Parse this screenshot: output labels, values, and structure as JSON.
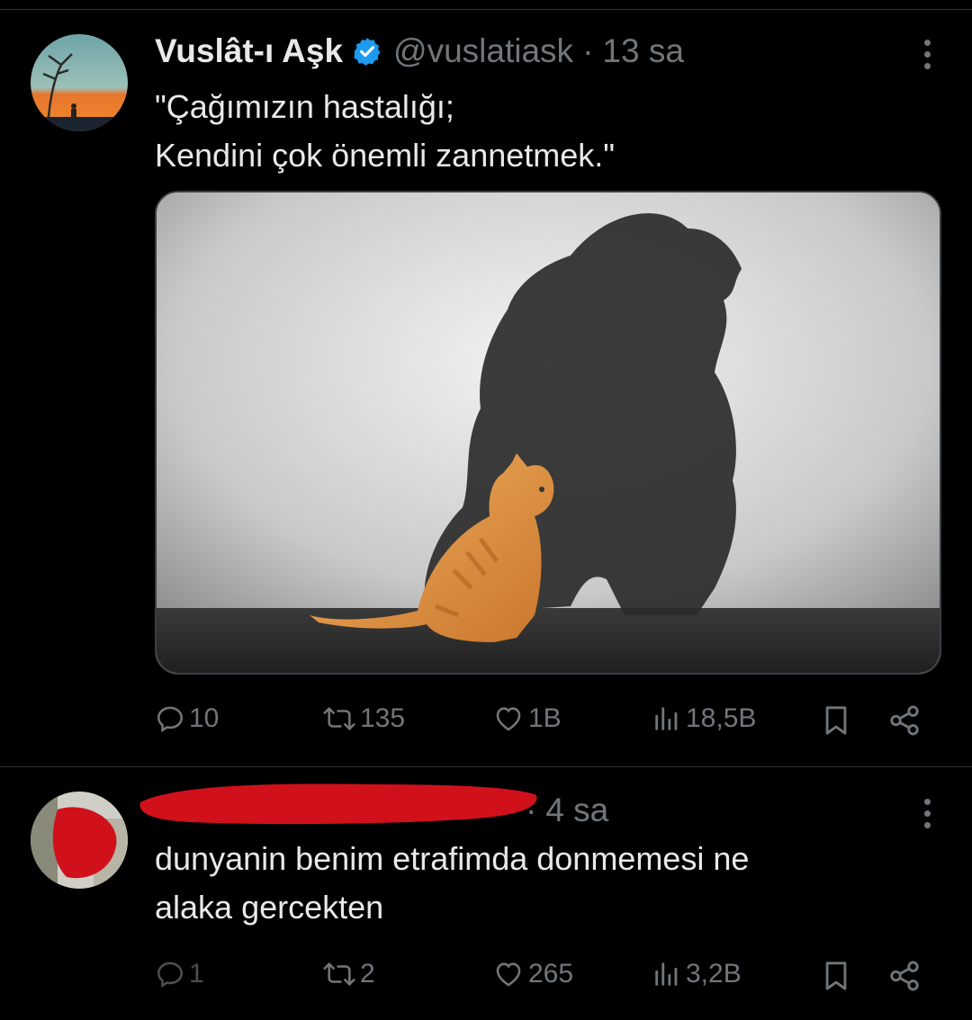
{
  "tweet": {
    "author_name": "Vuslât-ı Aşk",
    "handle": "@vuslatiask",
    "separator": "·",
    "time": "13 sa",
    "text": "\"Çağımızın hastalığı;\nKendini çok önemli zannetmek.\"",
    "image_description_icon": "cat-lion-shadow-image",
    "stats": {
      "replies": "10",
      "reposts": "135",
      "likes": "1B",
      "views": "18,5B"
    }
  },
  "reply": {
    "separator": "·",
    "time": "4 sa",
    "text": "dunyanin benim etrafimda donmemesi ne\nalaka gercekten",
    "stats": {
      "replies": "1",
      "reposts": "2",
      "likes": "265",
      "views": "3,2B"
    }
  },
  "colors": {
    "background": "#000000",
    "text": "#e7e9ea",
    "muted": "#71767b",
    "verified": "#1d9bf0",
    "redaction": "#d0111c"
  },
  "icons": [
    "reply-icon",
    "repost-icon",
    "like-icon",
    "views-icon",
    "bookmark-icon",
    "share-icon",
    "more-icon",
    "verified-badge-icon"
  ]
}
